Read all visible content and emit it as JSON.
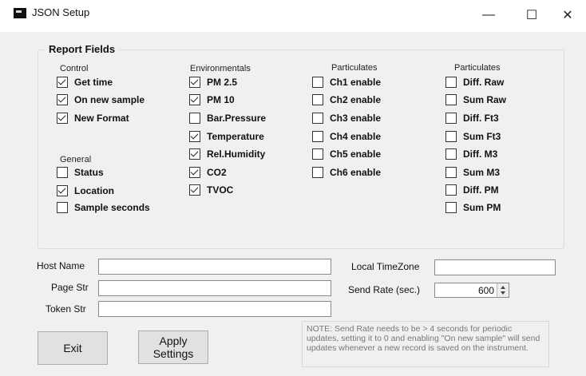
{
  "window": {
    "title": "JSON Setup",
    "minimize": "—",
    "maximize": "☐",
    "close": "✕"
  },
  "group": {
    "title": "Report Fields"
  },
  "control": {
    "heading": "Control",
    "items": [
      {
        "label": "Get time",
        "checked": true
      },
      {
        "label": "On new sample",
        "checked": true
      },
      {
        "label": "New Format",
        "checked": true
      }
    ]
  },
  "general": {
    "heading": "General",
    "items": [
      {
        "label": "Status",
        "checked": false
      },
      {
        "label": "Location",
        "checked": true
      },
      {
        "label": "Sample seconds",
        "checked": false
      }
    ]
  },
  "environmentals": {
    "heading": "Environmentals",
    "items": [
      {
        "label": "PM 2.5",
        "checked": true
      },
      {
        "label": "PM 10",
        "checked": true
      },
      {
        "label": "Bar.Pressure",
        "checked": false
      },
      {
        "label": "Temperature",
        "checked": true
      },
      {
        "label": "Rel.Humidity",
        "checked": true
      },
      {
        "label": "CO2",
        "checked": true
      },
      {
        "label": "TVOC",
        "checked": true
      }
    ]
  },
  "particulates1": {
    "heading": "Particulates",
    "items": [
      {
        "label": "Ch1 enable",
        "checked": false
      },
      {
        "label": "Ch2 enable",
        "checked": false
      },
      {
        "label": "Ch3 enable",
        "checked": false
      },
      {
        "label": "Ch4 enable",
        "checked": false
      },
      {
        "label": "Ch5 enable",
        "checked": false
      },
      {
        "label": "Ch6 enable",
        "checked": false
      }
    ]
  },
  "particulates2": {
    "heading": "Particulates",
    "items": [
      {
        "label": "Diff. Raw",
        "checked": false
      },
      {
        "label": "Sum Raw",
        "checked": false
      },
      {
        "label": "Diff. Ft3",
        "checked": false
      },
      {
        "label": "Sum Ft3",
        "checked": false
      },
      {
        "label": "Diff. M3",
        "checked": false
      },
      {
        "label": "Sum M3",
        "checked": false
      },
      {
        "label": "Diff. PM",
        "checked": false
      },
      {
        "label": "Sum PM",
        "checked": false
      }
    ]
  },
  "fields": {
    "host_name_label": "Host Name",
    "host_name_value": "",
    "page_str_label": "Page Str",
    "page_str_value": "",
    "token_str_label": "Token Str",
    "token_str_value": "",
    "local_timezone_label": "Local TimeZone",
    "local_timezone_value": "",
    "send_rate_label": "Send Rate (sec.)",
    "send_rate_value": "600"
  },
  "buttons": {
    "exit": "Exit",
    "apply": "Apply\nSettings"
  },
  "note": "NOTE:  Send Rate needs to be > 4 seconds for periodic updates, setting it to 0 and enabling \"On new sample\" will send updates whenever a new record is saved on the instrument."
}
